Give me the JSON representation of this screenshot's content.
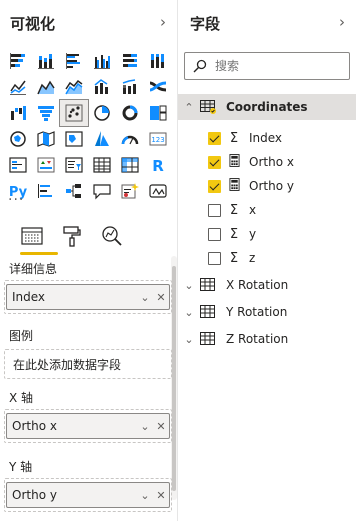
{
  "visualizations": {
    "title": "可视化",
    "more": "···",
    "icons": [
      [
        "stacked-bar-chart-icon",
        "stacked-column-chart-icon",
        "clustered-bar-chart-icon",
        "clustered-column-chart-icon",
        "100-stacked-bar-chart-icon",
        "100-stacked-column-chart-icon"
      ],
      [
        "line-chart-icon",
        "area-chart-icon",
        "stacked-area-chart-icon",
        "line-clustered-column-chart-icon",
        "line-stacked-column-chart-icon",
        "ribbon-chart-icon"
      ],
      [
        "waterfall-chart-icon",
        "funnel-chart-icon",
        "scatter-chart-icon",
        "pie-chart-icon",
        "donut-chart-icon",
        "treemap-icon"
      ],
      [
        "map-icon",
        "filled-map-icon",
        "shape-map-icon",
        "azure-map-icon",
        "gauge-icon",
        "card-icon"
      ],
      [
        "multi-row-card-icon",
        "kpi-icon",
        "slicer-icon",
        "table-icon",
        "matrix-icon",
        "r-visual-icon"
      ],
      [
        "python-visual-icon",
        "key-influencers-icon",
        "decomposition-tree-icon",
        "qa-icon",
        "smart-narrative-icon",
        "paginated-report-icon"
      ]
    ],
    "wells": {
      "details_label": "详细信息",
      "details_value": "Index",
      "legend_label": "图例",
      "legend_placeholder": "在此处添加数据字段",
      "x_label": "X 轴",
      "x_value": "Ortho x",
      "y_label": "Y 轴",
      "y_value": "Ortho y"
    }
  },
  "fields": {
    "title": "字段",
    "search_placeholder": "搜索",
    "tables": [
      {
        "name": "Coordinates",
        "expanded": true
      },
      {
        "name": "X Rotation",
        "expanded": false
      },
      {
        "name": "Y Rotation",
        "expanded": false
      },
      {
        "name": "Z Rotation",
        "expanded": false
      }
    ],
    "coordinate_fields": [
      {
        "name": "Index",
        "type": "Σ",
        "checked": true
      },
      {
        "name": "Ortho x",
        "type": "▦",
        "checked": true
      },
      {
        "name": "Ortho y",
        "type": "▦",
        "checked": true
      },
      {
        "name": "x",
        "type": "Σ",
        "checked": false
      },
      {
        "name": "y",
        "type": "Σ",
        "checked": false
      },
      {
        "name": "z",
        "type": "Σ",
        "checked": false
      }
    ]
  },
  "colors": {
    "accent": "#f2c811",
    "tab_underline": "#e8b600",
    "icon_blue": "#118dff",
    "icon_dark": "#252423",
    "selected_row": "#e1dfdd"
  }
}
